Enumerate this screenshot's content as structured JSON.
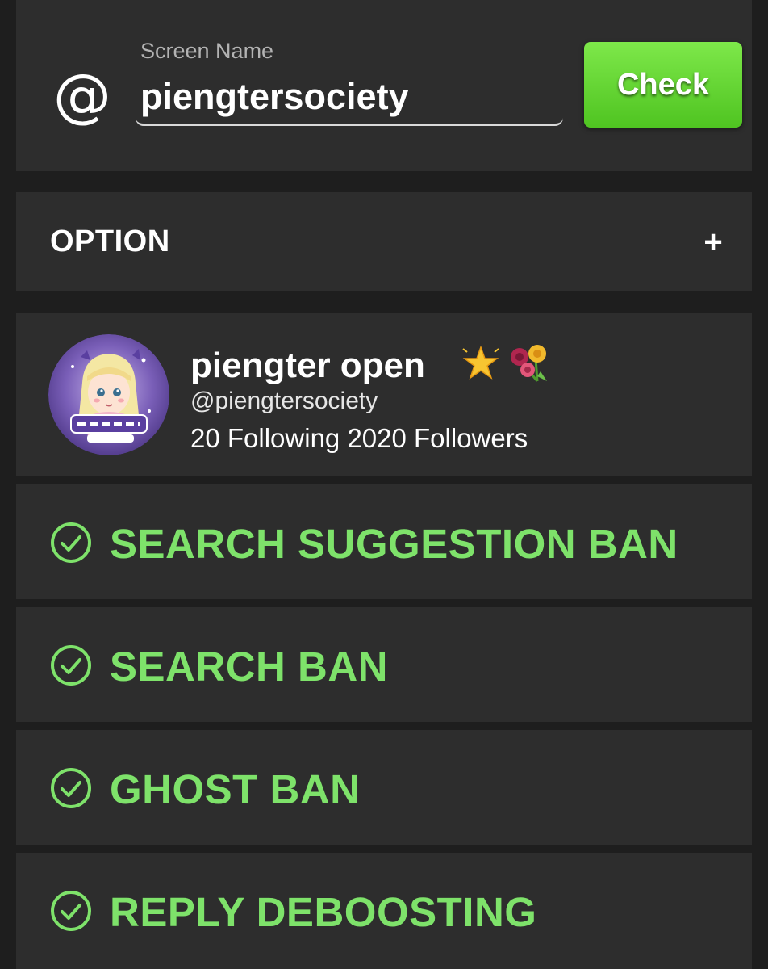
{
  "search": {
    "at_symbol": "@",
    "label": "Screen Name",
    "value": "piengtersociety",
    "check_label": "Check"
  },
  "option": {
    "label": "OPTION",
    "toggle": "+"
  },
  "profile": {
    "display_name": "piengter open",
    "display_emoji": [
      "star-icon",
      "bouquet-icon"
    ],
    "handle": "@piengtersociety",
    "stats": "20 Following 2020 Followers",
    "avatar_icon": "avatar-cartoon-girl"
  },
  "results": [
    {
      "label": "SEARCH SUGGESTION BAN",
      "status_icon": "check-circle-icon"
    },
    {
      "label": "SEARCH BAN",
      "status_icon": "check-circle-icon"
    },
    {
      "label": "GHOST BAN",
      "status_icon": "check-circle-icon"
    },
    {
      "label": "REPLY DEBOOSTING",
      "status_icon": "check-circle-icon"
    }
  ],
  "colors": {
    "background": "#1e1e1e",
    "panel": "#2d2d2d",
    "accent_green": "#7ee26a",
    "button_green": "#5ccf2b"
  }
}
